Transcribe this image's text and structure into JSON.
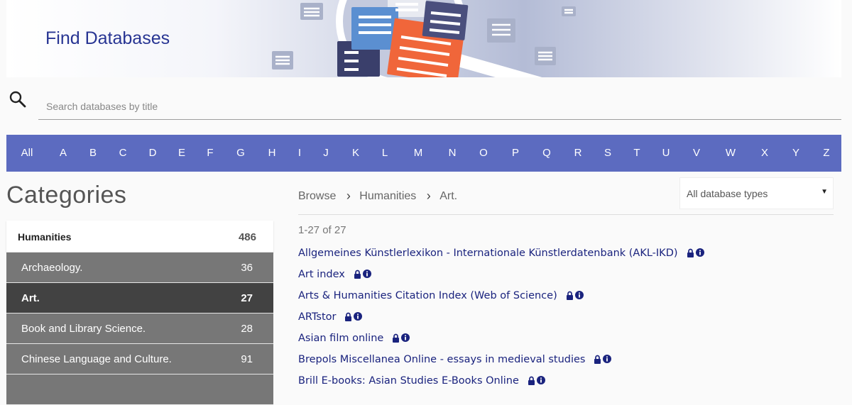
{
  "header": {
    "title": "Find Databases"
  },
  "search": {
    "placeholder": "Search databases by title"
  },
  "alphabet": [
    "All",
    "A",
    "B",
    "C",
    "D",
    "E",
    "F",
    "G",
    "H",
    "I",
    "J",
    "K",
    "L",
    "M",
    "N",
    "O",
    "P",
    "Q",
    "R",
    "S",
    "T",
    "U",
    "V",
    "W",
    "X",
    "Y",
    "Z"
  ],
  "categories": {
    "heading": "Categories",
    "items": [
      {
        "label": "Humanities",
        "count": "486"
      },
      {
        "label": "Archaeology.",
        "count": "36"
      },
      {
        "label": "Art.",
        "count": "27"
      },
      {
        "label": "Book and Library Science.",
        "count": "28"
      },
      {
        "label": "Chinese Language and Culture.",
        "count": "91"
      }
    ]
  },
  "breadcrumb": [
    "Browse",
    "Humanities",
    "Art."
  ],
  "type_filter": {
    "selected": "All database types"
  },
  "results": {
    "count_text": "1-27 of 27",
    "items": [
      "Allgemeines Künstlerlexikon - Internationale Künstlerdatenbank (AKL-IKD)",
      "Art index",
      "Arts & Humanities Citation Index (Web of Science)",
      "ARTstor",
      "Asian film online",
      "Brepols Miscellanea Online - essays in medieval studies",
      "Brill E-books: Asian Studies E-Books Online"
    ]
  },
  "colors": {
    "title": "#283593",
    "alphabet_bar": "#5c6bc0",
    "link": "#1a237e",
    "category_active": "#424242",
    "category_sub": "#777777"
  }
}
